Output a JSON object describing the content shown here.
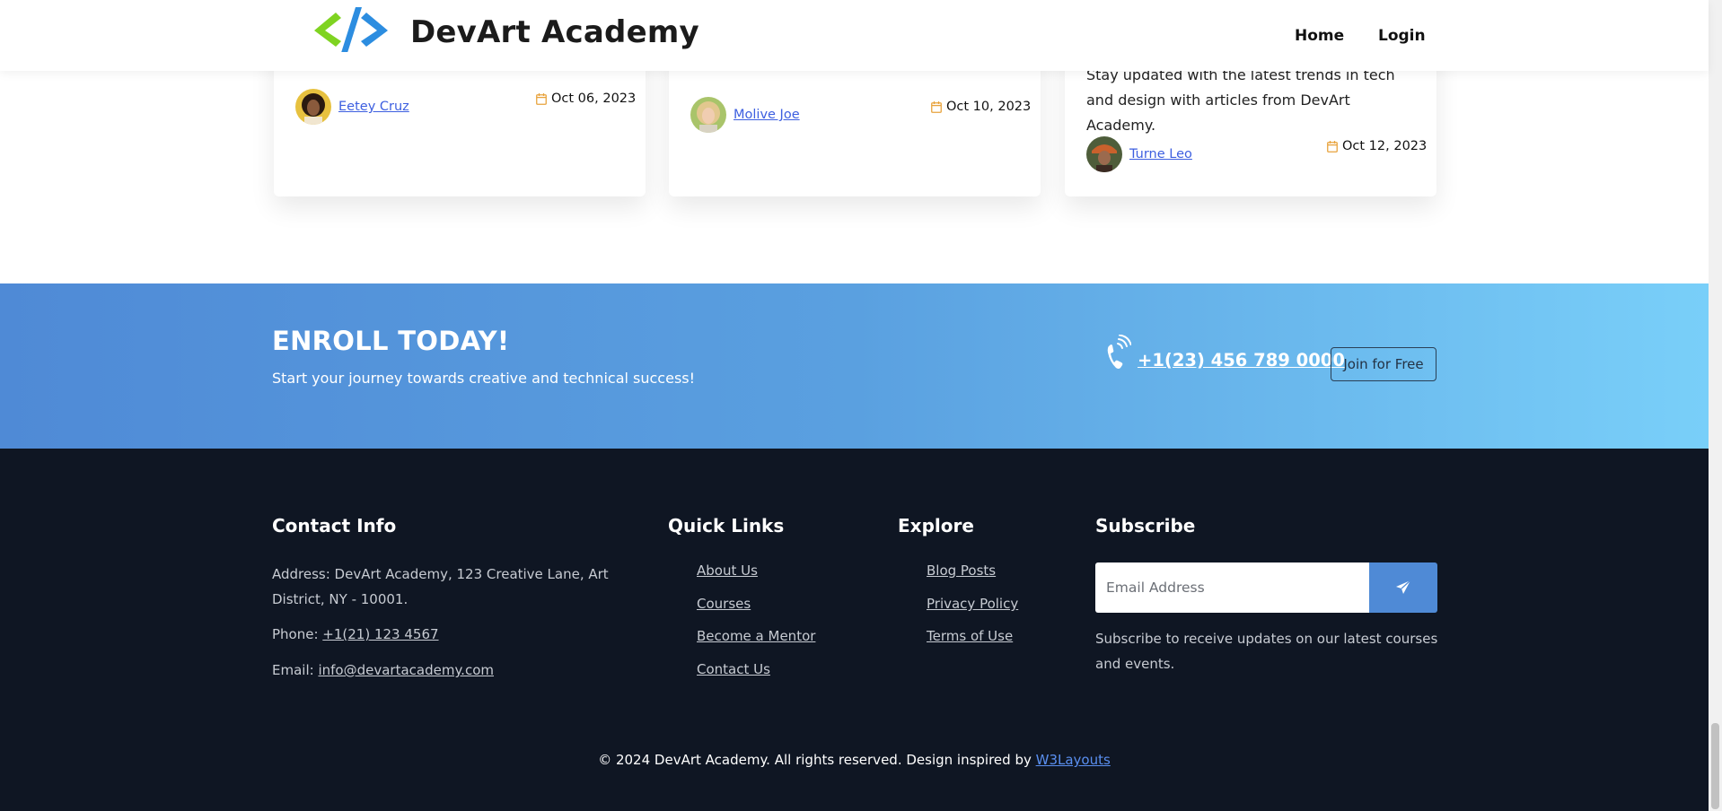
{
  "header": {
    "brand": "DevArt Academy",
    "nav": [
      "Home",
      "Login"
    ]
  },
  "cards": [
    {
      "text": "",
      "author": "Eetey Cruz",
      "date": "Oct 06, 2023"
    },
    {
      "text": "",
      "author": "Molive Joe",
      "date": "Oct 10, 2023"
    },
    {
      "text": "Stay updated with the latest trends in tech and design with articles from DevArt Academy.",
      "author": "Turne Leo",
      "date": "Oct 12, 2023"
    }
  ],
  "enroll": {
    "title": "ENROLL TODAY!",
    "subtitle": "Start your journey towards creative and technical success!",
    "phone": "+1(23) 456 789 0000",
    "join_label": "Join for Free"
  },
  "footer": {
    "contact": {
      "heading": "Contact Info",
      "address": "Address: DevArt Academy, 123 Creative Lane, Art District, NY - 10001.",
      "phone_label": "Phone: ",
      "phone": "+1(21) 123 4567",
      "email_label": "Email: ",
      "email": "info@devartacademy.com"
    },
    "quick_links": {
      "heading": "Quick Links",
      "items": [
        "About Us",
        "Courses",
        "Become a Mentor",
        "Contact Us"
      ]
    },
    "explore": {
      "heading": "Explore",
      "items": [
        "Blog Posts",
        "Privacy Policy",
        "Terms of Use"
      ]
    },
    "subscribe": {
      "heading": "Subscribe",
      "placeholder": "Email Address",
      "note": "Subscribe to receive updates on our latest courses and events."
    },
    "copyright": "© 2024 DevArt Academy. All rights reserved. Design inspired by ",
    "credit": "W3Layouts"
  },
  "icons": {
    "logo": "code-brackets-logo-icon",
    "date": "calendar-icon",
    "phone": "phone-ringing-icon",
    "send": "paper-plane-icon"
  },
  "colors": {
    "accent": "#4f8ad6",
    "link": "#3d5fe0",
    "date_icon": "#e8a33d",
    "footer_bg": "#0f1623"
  }
}
